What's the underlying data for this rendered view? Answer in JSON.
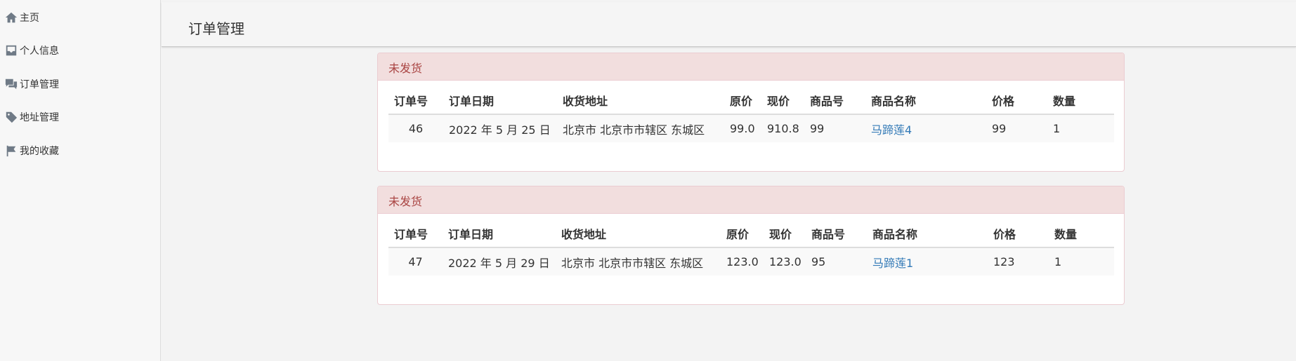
{
  "sidebar": {
    "items": [
      {
        "label": "主页",
        "icon": "home-icon"
      },
      {
        "label": "个人信息",
        "icon": "inbox-icon"
      },
      {
        "label": "订单管理",
        "icon": "comments-icon"
      },
      {
        "label": "地址管理",
        "icon": "tag-icon"
      },
      {
        "label": "我的收藏",
        "icon": "flag-icon"
      }
    ]
  },
  "header": {
    "title": "订单管理"
  },
  "table_headers": [
    "订单号",
    "订单日期",
    "收货地址",
    "原价",
    "现价",
    "商品号",
    "商品名称",
    "价格",
    "数量"
  ],
  "orders": [
    {
      "status": "未发货",
      "row": {
        "order_no": "46",
        "date": "2022 年 5 月 25 日",
        "address": "北京市 北京市市辖区 东城区",
        "original_price": "99.0",
        "current_price": "910.8",
        "product_no": "99",
        "product_name": "马蹄莲4",
        "price": "99",
        "quantity": "1"
      }
    },
    {
      "status": "未发货",
      "row": {
        "order_no": "47",
        "date": "2022 年 5 月 29 日",
        "address": "北京市 北京市市辖区 东城区",
        "original_price": "123.0",
        "current_price": "123.0",
        "product_no": "95",
        "product_name": "马蹄莲1",
        "price": "123",
        "quantity": "1"
      }
    }
  ],
  "colors": {
    "panel_heading_bg": "#f2dede",
    "panel_heading_text": "#a94442",
    "link": "#337ab7"
  }
}
